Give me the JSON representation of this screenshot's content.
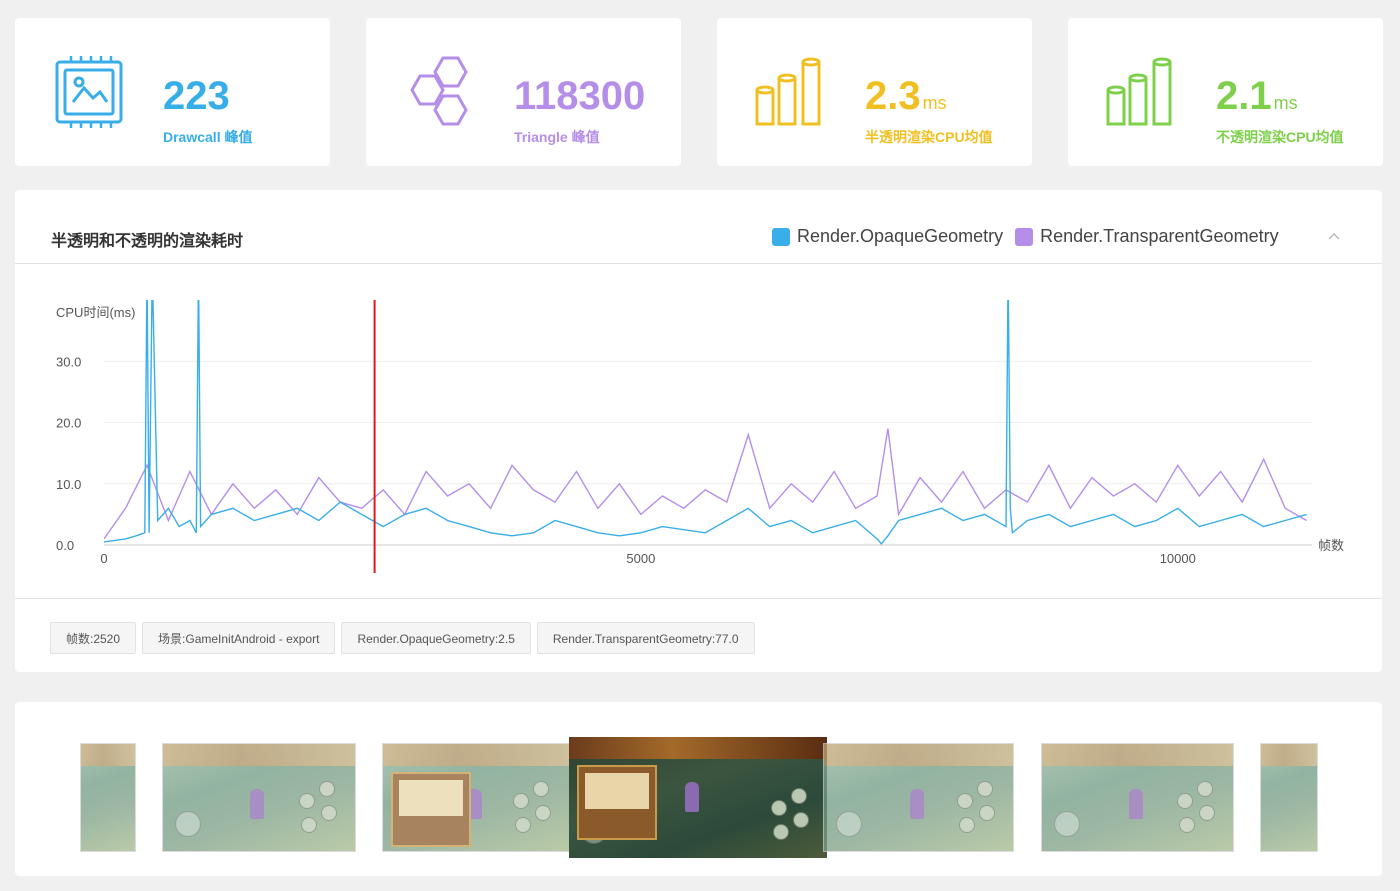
{
  "stats": [
    {
      "value": "223",
      "unit": "",
      "label": "Drawcall 峰值",
      "color": "#38aee9",
      "icon": "chip-image-icon"
    },
    {
      "value": "118300",
      "unit": "",
      "label": "Triangle 峰值",
      "color": "#b58ee9",
      "icon": "hexagons-icon"
    },
    {
      "value": "2.3",
      "unit": "ms",
      "label": "半透明渲染CPU均值",
      "color": "#f0c022",
      "icon": "bar-cylinders-icon"
    },
    {
      "value": "2.1",
      "unit": "ms",
      "label": "不透明渲染CPU均值",
      "color": "#7ed04a",
      "icon": "bar-cylinders-icon"
    }
  ],
  "panel": {
    "title": "半透明和不透明的渲染耗时",
    "legend": [
      {
        "name": "Render.OpaqueGeometry",
        "color": "#3aaee8"
      },
      {
        "name": "Render.TransparentGeometry",
        "color": "#b58ee9"
      }
    ],
    "collapse_icon": "chevron-up-icon",
    "tags": [
      "帧数:2520",
      "场景:GameInitAndroid - export",
      "Render.OpaqueGeometry:2.5",
      "Render.TransparentGeometry:77.0"
    ]
  },
  "chart_data": {
    "type": "line",
    "ylabel": "CPU时间(ms)",
    "xlabel": "帧数",
    "y_ticks": [
      "0.0",
      "10.0",
      "20.0",
      "30.0"
    ],
    "x_ticks": [
      "0",
      "5000",
      "10000"
    ],
    "xlim": [
      0,
      11250
    ],
    "ylim": [
      0,
      40
    ],
    "grid": true,
    "legend_position": "top-right",
    "selected_frame": 2520,
    "selected_color": "#e0191b",
    "series": [
      {
        "name": "Render.OpaqueGeometry",
        "color": "#3aaee8",
        "x": [
          0,
          200,
          300,
          380,
          400,
          420,
          450,
          500,
          600,
          700,
          800,
          860,
          880,
          900,
          1000,
          1200,
          1400,
          1600,
          1800,
          2000,
          2200,
          2400,
          2600,
          2800,
          3000,
          3200,
          3400,
          3600,
          3800,
          4000,
          4200,
          4400,
          4600,
          4800,
          5000,
          5200,
          5400,
          5600,
          5800,
          6000,
          6200,
          6400,
          6600,
          6800,
          7000,
          7200,
          7240,
          7300,
          7400,
          7600,
          7800,
          8000,
          8200,
          8400,
          8420,
          8440,
          8460,
          8600,
          8800,
          9000,
          9200,
          9400,
          9600,
          9800,
          10000,
          10200,
          10400,
          10600,
          10800,
          11000,
          11200
        ],
        "y": [
          0.5,
          1.0,
          1.5,
          2.0,
          45,
          2.0,
          45,
          4.0,
          6.0,
          3.0,
          4.0,
          2.0,
          45,
          3.0,
          5.0,
          6.0,
          4.0,
          5.0,
          6.0,
          4.0,
          7.0,
          5.0,
          3.0,
          5.0,
          6.0,
          4.0,
          3.0,
          2.0,
          1.5,
          2.0,
          4.0,
          3.0,
          2.0,
          1.5,
          2.0,
          3.0,
          2.5,
          2.0,
          4.0,
          6.0,
          3.0,
          4.0,
          2.0,
          3.0,
          4.0,
          1.0,
          0.2,
          1.5,
          4.0,
          5.0,
          6.0,
          4.0,
          5.0,
          3.0,
          45,
          6.0,
          2.0,
          4.0,
          5.0,
          3.0,
          4.0,
          5.0,
          3.0,
          4.0,
          6.0,
          3.0,
          4.0,
          5.0,
          3.0,
          4.0,
          5.0
        ]
      },
      {
        "name": "Render.TransparentGeometry",
        "color": "#b58ee9",
        "x": [
          0,
          200,
          400,
          600,
          800,
          1000,
          1200,
          1400,
          1600,
          1800,
          2000,
          2200,
          2400,
          2600,
          2800,
          3000,
          3200,
          3400,
          3600,
          3800,
          4000,
          4200,
          4400,
          4600,
          4800,
          5000,
          5200,
          5400,
          5600,
          5800,
          6000,
          6200,
          6400,
          6600,
          6800,
          7000,
          7200,
          7300,
          7400,
          7600,
          7800,
          8000,
          8200,
          8400,
          8600,
          8800,
          9000,
          9200,
          9400,
          9600,
          9800,
          10000,
          10200,
          10400,
          10600,
          10800,
          11000,
          11200
        ],
        "y": [
          1.0,
          6.0,
          13,
          4.0,
          12,
          5.0,
          10,
          6.0,
          9.0,
          5.0,
          11,
          7.0,
          6.0,
          9.0,
          5.0,
          12,
          8.0,
          10,
          6.0,
          13,
          9.0,
          7.0,
          12,
          6.0,
          10,
          5.0,
          8.0,
          6.0,
          9.0,
          7.0,
          18,
          6.0,
          10,
          7.0,
          12,
          6.0,
          8.0,
          19,
          5.0,
          11,
          7.0,
          12,
          6.0,
          9.0,
          7.0,
          13,
          6.0,
          11,
          8.0,
          10,
          7.0,
          13,
          8.0,
          12,
          7.0,
          14,
          6.0,
          4.0
        ]
      }
    ]
  },
  "screenshots": [
    {
      "name": "frame-thumbnail",
      "active": false
    },
    {
      "name": "frame-thumbnail",
      "active": false
    },
    {
      "name": "frame-thumbnail",
      "active": false
    },
    {
      "name": "frame-thumbnail-selected",
      "active": true
    },
    {
      "name": "frame-thumbnail",
      "active": false
    },
    {
      "name": "frame-thumbnail",
      "active": false
    },
    {
      "name": "frame-thumbnail",
      "active": false
    }
  ]
}
